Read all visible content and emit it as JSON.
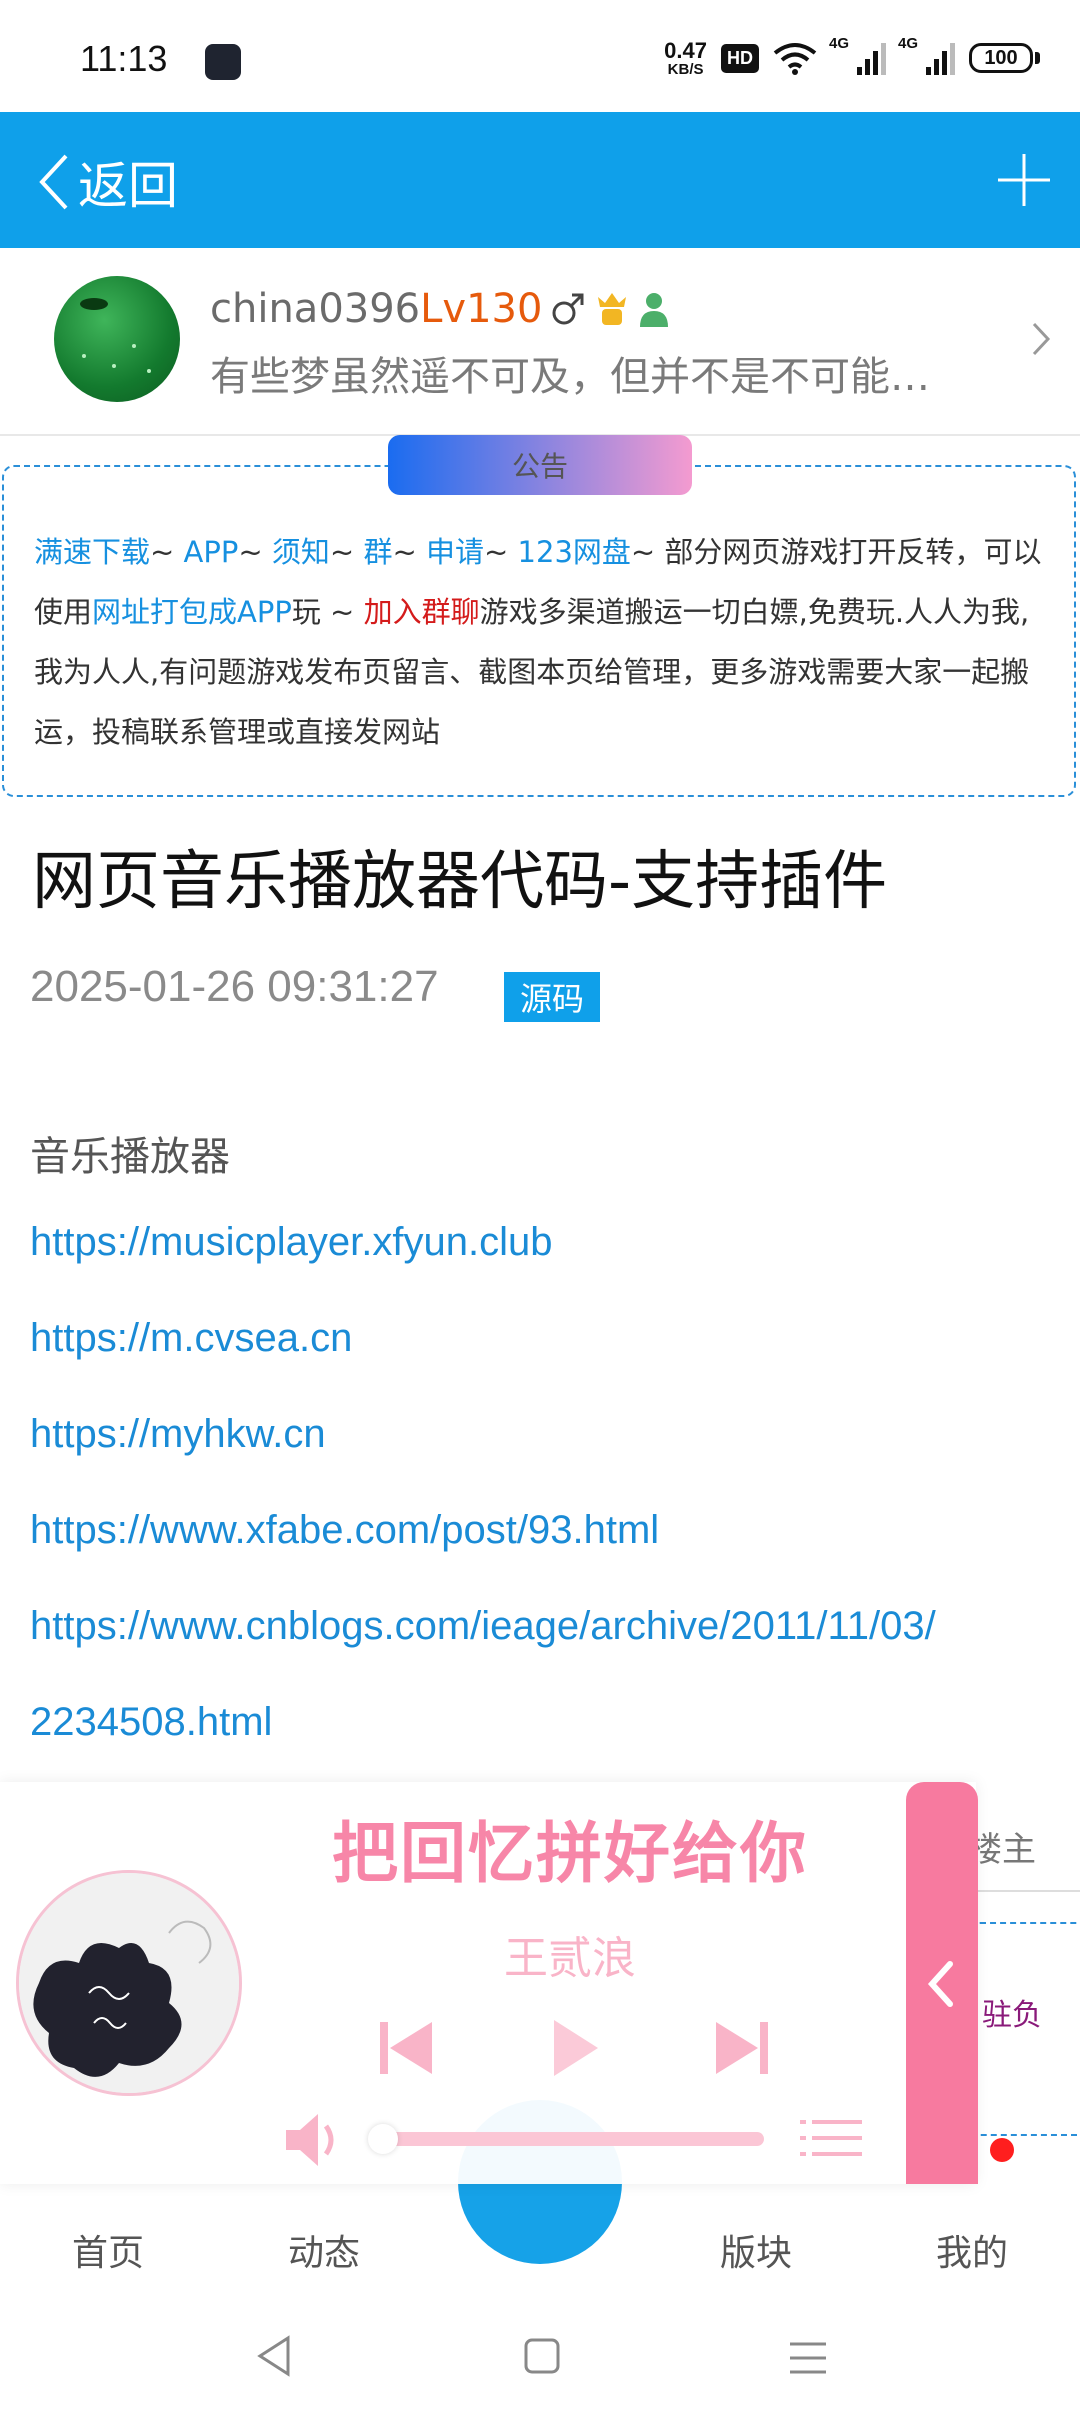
{
  "status_bar": {
    "time": "11:13",
    "net_speed_value": "0.47",
    "net_speed_unit": "KB/S",
    "hd_label": "HD",
    "signal1_label": "4G",
    "signal2_label": "4G",
    "battery": "100"
  },
  "header": {
    "back_label": "返回"
  },
  "user": {
    "name": "china0396",
    "level": "Lv130",
    "signature": "有些梦虽然遥不可及，但并不是不可能…"
  },
  "notice": {
    "title": "公告",
    "links": [
      "满速下载",
      "APP",
      "须知",
      "群",
      "申请",
      "123网盘"
    ],
    "sep": "~",
    "text1": " 部分网页游戏打开反转，可以使用",
    "link_pack": "网址打包成APP",
    "text2": "玩 ~ ",
    "link_join": "加入群聊",
    "text3": "游戏多渠道搬运一切白嫖,免费玩.人人为我,我为人人,有问题游戏发布页留言、截图本页给管理，更多游戏需要大家一起搬运，投稿联系管理或直接发网站"
  },
  "article": {
    "title": "网页音乐播放器代码-支持插件",
    "datetime": "2025-01-26 09:31:27",
    "tag": "源码",
    "intro": "音乐播放器",
    "links": [
      "https://musicplayer.xfyun.club",
      "https://m.cvsea.cn",
      "https://myhkw.cn",
      "https://www.xfabe.com/post/93.html",
      "https://www.cnblogs.com/ieage/archive/2011/11/03/",
      "2234508.html"
    ]
  },
  "partial": {
    "louzhu": "楼主",
    "hidden_text": "驻负"
  },
  "player": {
    "song_title": "把回忆拼好给你",
    "artist": "王贰浪",
    "progress": 0.0
  },
  "bottom_nav": {
    "items": [
      "首页",
      "动态",
      "版块",
      "我的"
    ]
  },
  "colors": {
    "primary": "#0fa0ea",
    "player_pink": "#f77a9f",
    "link": "#1a8bd6",
    "level": "#e65a0c"
  }
}
